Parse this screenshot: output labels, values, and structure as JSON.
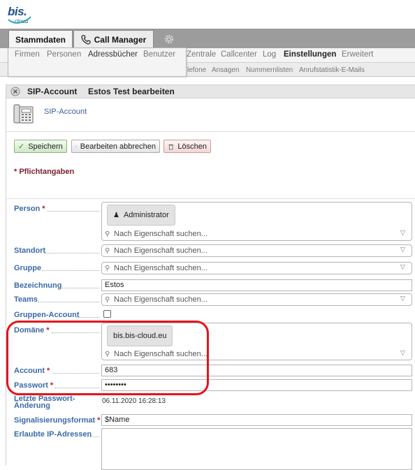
{
  "logo": {
    "text": "bis.",
    "sub": "cloud"
  },
  "tabs": [
    {
      "label": "Stammdaten"
    },
    {
      "label": "Call Manager"
    }
  ],
  "icons": {
    "gear": "gear-icon",
    "phone": "phone-icon",
    "close": "close-circle-icon",
    "check": "check-icon",
    "cancel": "cancel-circle-icon",
    "trash": "trash-icon",
    "search": "search-icon",
    "chevron": "chevron-down-icon",
    "user": "user-icon"
  },
  "dropdown": {
    "items": [
      "Firmen",
      "Personen",
      "Adressbücher",
      "Benutzer"
    ]
  },
  "subnav": {
    "items": [
      "Zentrale",
      "Callcenter",
      "Log",
      "Einstellungen",
      "Erweitert"
    ]
  },
  "subnav2": {
    "items": [
      "lefone",
      "Ansagen",
      "Nummernlisten",
      "Anrufstatistik-E-Mails"
    ]
  },
  "panel": {
    "title": "SIP-Account",
    "subtitle": "Estos Test bearbeiten",
    "section_label": "SIP-Account"
  },
  "buttons": {
    "save": "Speichern",
    "cancel": "Bearbeiten abbrechen",
    "delete": "Löschen"
  },
  "required_note": "* Pflichtangaben",
  "form": {
    "search_placeholder": "Nach Eigenschaft suchen...",
    "person": {
      "label": "Person",
      "chip": "Administrator"
    },
    "standort": {
      "label": "Standort"
    },
    "gruppe": {
      "label": "Gruppe"
    },
    "bezeichnung": {
      "label": "Bezeichnung",
      "value": "Estos"
    },
    "teams": {
      "label": "Teams"
    },
    "gruppen_account": {
      "label": "Gruppen-Account",
      "checked": false
    },
    "domaene": {
      "label": "Domäne",
      "chip": "bis.bis-cloud.eu"
    },
    "account": {
      "label": "Account",
      "value": "683"
    },
    "passwort": {
      "label": "Passwort",
      "value": "••••••••"
    },
    "letzte_aenderung": {
      "label_line1": "Letzte Passwort-",
      "label_line2": "Änderung",
      "value": "06.11.2020 16:28:13"
    },
    "signalisierungsformat": {
      "label": "Signalisierungsformat",
      "value": "$Name"
    },
    "erlaubte_ip": {
      "label": "Erlaubte IP-Adressen"
    }
  },
  "colors": {
    "label_blue": "#3b6aa8",
    "required_red": "#b0201f",
    "highlight": "#e4141b"
  }
}
